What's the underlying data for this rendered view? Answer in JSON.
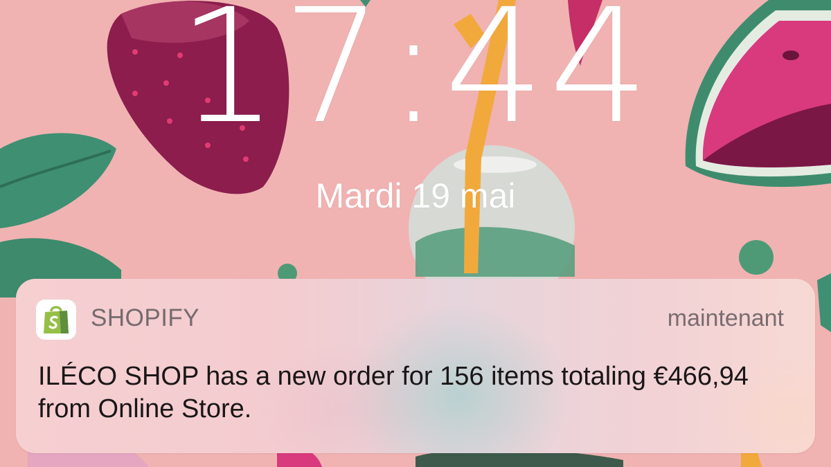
{
  "lock_screen": {
    "time": "17:44",
    "date": "Mardi 19 mai"
  },
  "notification": {
    "app_icon": "shopify-bag-icon",
    "app_name": "SHOPIFY",
    "timestamp": "maintenant",
    "message": "ILÉCO SHOP has a new order for 156 items totaling €466,94 from Online Store."
  },
  "colors": {
    "wallpaper": "#f0b3b2",
    "shopify_green": "#95bf47",
    "text_white": "#ffffff",
    "message_text": "#1a1617"
  }
}
